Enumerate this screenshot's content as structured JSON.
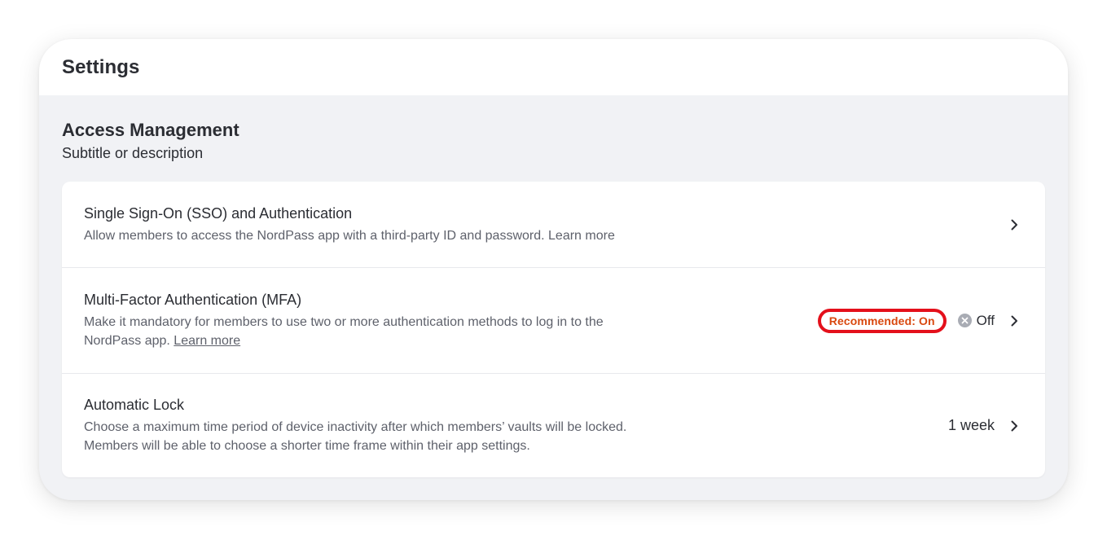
{
  "header": {
    "title": "Settings"
  },
  "section": {
    "title": "Access Management",
    "subtitle": "Subtitle or description"
  },
  "rows": [
    {
      "title": "Single Sign-On (SSO) and Authentication",
      "description": "Allow members to access the NordPass app with a third-party ID and password.",
      "link": "Learn more",
      "icon": "chevron-right-icon"
    },
    {
      "title": "Multi-Factor Authentication (MFA)",
      "description_line1": "Make it mandatory for members to use two or more authentication methods to log in to the",
      "description_line2": "NordPass app.",
      "link": "Learn more",
      "badge": "Recommended: On",
      "status": "Off",
      "status_icon": "x-circle-icon",
      "icon": "chevron-right-icon"
    },
    {
      "title": "Automatic Lock",
      "description_line1": "Choose a maximum time period of device inactivity after which members’ vaults will be locked.",
      "description_line2": "Members will be able to choose a shorter time frame within their app settings.",
      "value": "1 week",
      "icon": "chevron-right-icon"
    }
  ],
  "colors": {
    "highlight_ring": "#e4101b",
    "badge_text": "#d9480f",
    "background": "#f1f2f5"
  }
}
